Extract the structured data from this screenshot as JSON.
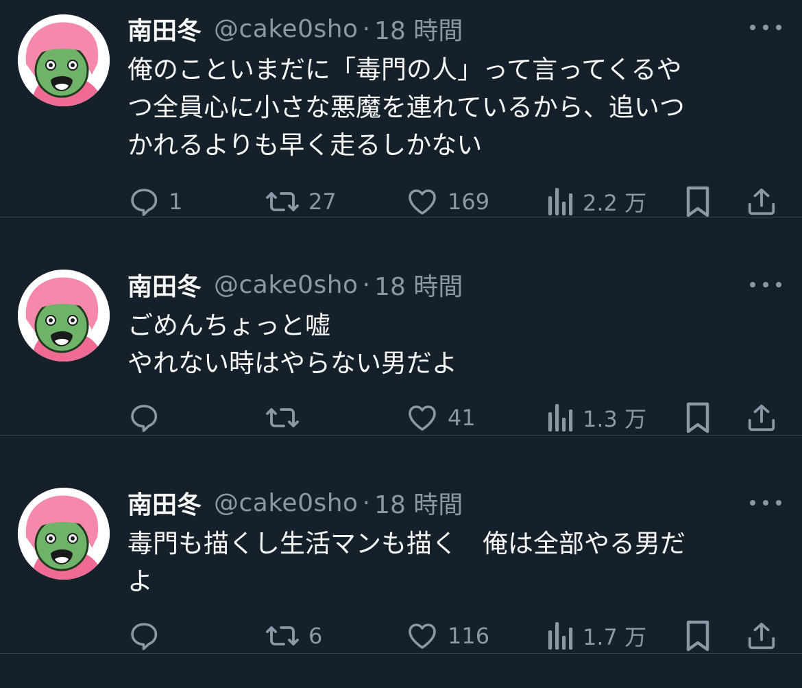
{
  "tweets": [
    {
      "name": "南田冬",
      "handle": "@cake0sho",
      "separator": "·",
      "time": "18 時間",
      "text_lines": [
        "俺のこといまだに「毒門の人」って言ってくるや",
        "つ全員心に小さな悪魔を連れているから、追いつ",
        "かれるよりも早く走るしかない"
      ],
      "replies": "1",
      "retweets": "27",
      "likes": "169",
      "views": "2.2 万"
    },
    {
      "name": "南田冬",
      "handle": "@cake0sho",
      "separator": "·",
      "time": "18 時間",
      "text_lines": [
        "ごめんちょっと嘘",
        "やれない時はやらない男だよ"
      ],
      "replies": "",
      "retweets": "",
      "likes": "41",
      "views": "1.3 万"
    },
    {
      "name": "南田冬",
      "handle": "@cake0sho",
      "separator": "·",
      "time": "18 時間",
      "text_lines": [
        "毒門も描くし生活マンも描く　俺は全部やる男だ",
        "よ"
      ],
      "replies": "",
      "retweets": "6",
      "likes": "116",
      "views": "1.7 万"
    }
  ],
  "colors": {
    "background": "#15202b",
    "divider": "#38444d",
    "text_primary": "#f7f9f9",
    "text_secondary": "#8b98a5"
  },
  "icons": {
    "reply": "speech-bubble-icon",
    "retweet": "retweet-arrows-icon",
    "like": "heart-icon",
    "views": "bar-chart-icon",
    "bookmark": "bookmark-icon",
    "share": "share-upload-icon",
    "more": "three-dots-icon"
  }
}
